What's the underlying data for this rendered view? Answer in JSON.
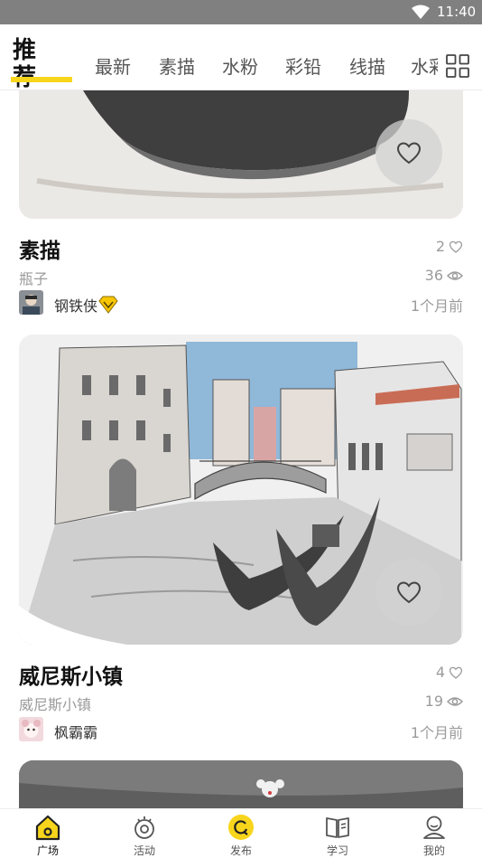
{
  "status_bar": {
    "time": "11:40"
  },
  "tabs": {
    "active": "推荐",
    "items": [
      "最新",
      "素描",
      "水粉",
      "彩铅",
      "线描"
    ],
    "clipped": "水彩"
  },
  "posts": [
    {
      "category": "素描",
      "subtitle": "瓶子",
      "author": "钢铁侠",
      "likes": "2",
      "views": "36",
      "time": "1个月前"
    },
    {
      "category": "威尼斯小镇",
      "subtitle": "威尼斯小镇",
      "author": "枫霸霸",
      "likes": "4",
      "views": "19",
      "time": "1个月前"
    }
  ],
  "bottom_nav": [
    {
      "label": "广场",
      "icon": "home-icon",
      "active": true
    },
    {
      "label": "活动",
      "icon": "activity-icon",
      "active": false
    },
    {
      "label": "发布",
      "icon": "publish-icon",
      "active": false
    },
    {
      "label": "学习",
      "icon": "book-icon",
      "active": false
    },
    {
      "label": "我的",
      "icon": "profile-icon",
      "active": false
    }
  ],
  "colors": {
    "accent": "#f7d51c",
    "status_bar": "#808080",
    "muted_text": "#9b9b9b"
  }
}
